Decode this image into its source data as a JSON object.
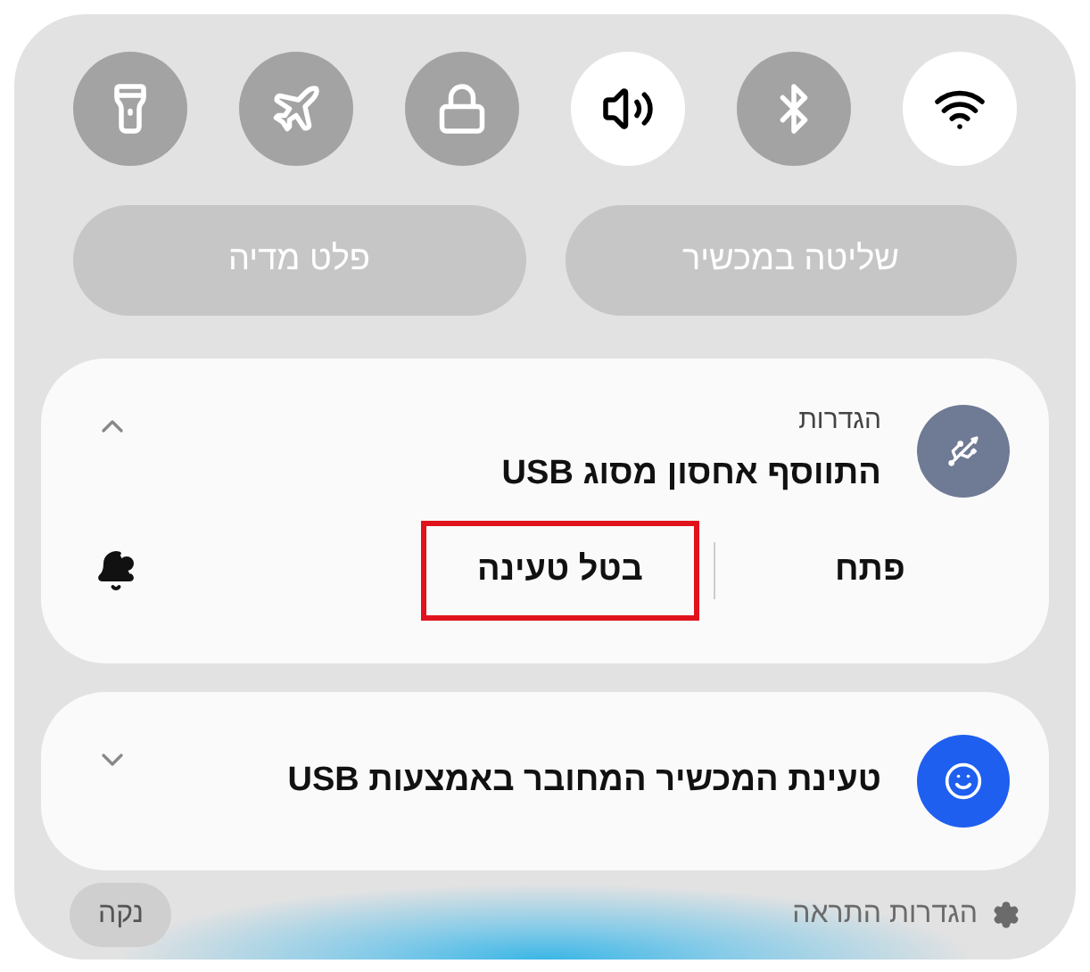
{
  "quick_tiles": [
    {
      "kind": "wifi",
      "on": true
    },
    {
      "kind": "bluetooth",
      "on": false
    },
    {
      "kind": "sound",
      "on": true
    },
    {
      "kind": "lock",
      "on": false
    },
    {
      "kind": "airplane",
      "on": false
    },
    {
      "kind": "flashlight",
      "on": false
    }
  ],
  "panel_buttons": [
    "שליטה במכשיר",
    "פלט מדיה"
  ],
  "notifications": [
    {
      "kind": "usb",
      "app": "הגדרות",
      "title": "התווסף אחסון מסוג USB",
      "expanded": true,
      "actions": [
        {
          "label": "פתח",
          "highlighted": false
        },
        {
          "label": "בטל טעינה",
          "highlighted": true
        }
      ]
    },
    {
      "kind": "charging",
      "title": "טעינת המכשיר המחובר באמצעות USB",
      "expanded": false
    }
  ],
  "footer": {
    "settings_link": "הגדרות התראה",
    "clear_button": "נקה"
  }
}
